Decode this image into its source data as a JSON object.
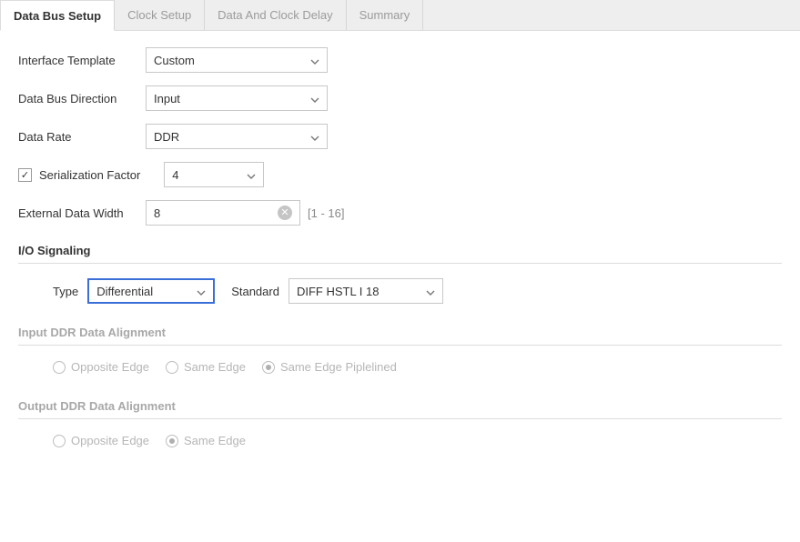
{
  "tabs": [
    {
      "label": "Data Bus Setup",
      "active": true
    },
    {
      "label": "Clock Setup",
      "active": false
    },
    {
      "label": "Data And Clock Delay",
      "active": false
    },
    {
      "label": "Summary",
      "active": false
    }
  ],
  "form": {
    "interface_template": {
      "label": "Interface Template",
      "value": "Custom"
    },
    "data_bus_direction": {
      "label": "Data Bus Direction",
      "value": "Input"
    },
    "data_rate": {
      "label": "Data Rate",
      "value": "DDR"
    },
    "serialization_factor": {
      "label": "Serialization Factor",
      "value": "4",
      "checked": true
    },
    "external_data_width": {
      "label": "External Data Width",
      "value": "8",
      "hint": "[1 - 16]"
    }
  },
  "io_signaling": {
    "title": "I/O Signaling",
    "type": {
      "label": "Type",
      "value": "Differential"
    },
    "standard": {
      "label": "Standard",
      "value": "DIFF HSTL I 18"
    }
  },
  "input_ddr": {
    "title": "Input DDR Data Alignment",
    "options": [
      {
        "label": "Opposite Edge",
        "selected": false
      },
      {
        "label": "Same Edge",
        "selected": false
      },
      {
        "label": "Same Edge Piplelined",
        "selected": true
      }
    ]
  },
  "output_ddr": {
    "title": "Output DDR Data Alignment",
    "options": [
      {
        "label": "Opposite Edge",
        "selected": false
      },
      {
        "label": "Same Edge",
        "selected": true
      }
    ]
  }
}
